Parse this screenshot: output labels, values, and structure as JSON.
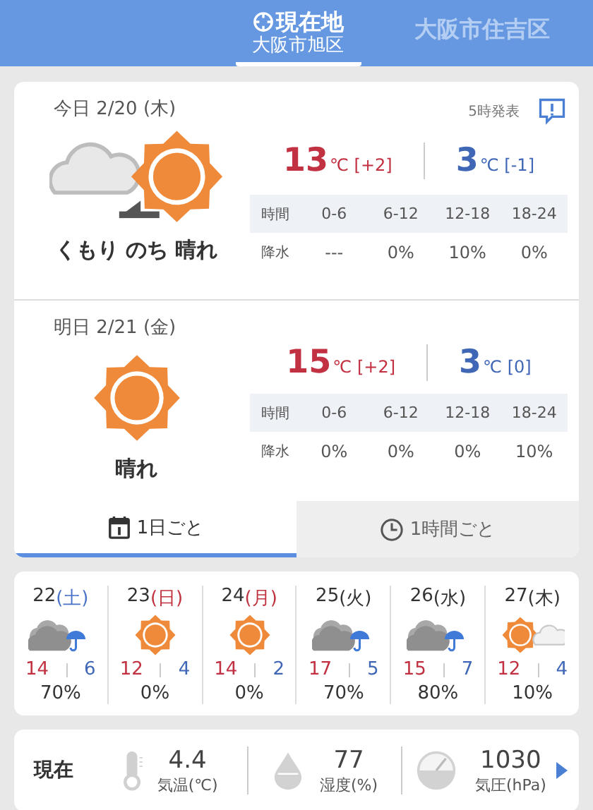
{
  "header": {
    "tabs": [
      {
        "title": "現在地",
        "subtitle": "大阪市旭区",
        "selected": true,
        "kind": "location"
      },
      {
        "title": "大阪市住吉区",
        "selected": false,
        "kind": "city"
      }
    ]
  },
  "days": [
    {
      "date": "今日 2/20 (木)",
      "issued": "5時発表",
      "report": true,
      "kind": "cloudy-then-sunny",
      "weather": "くもり のち 晴れ",
      "high": "13",
      "high_unit": "℃",
      "high_diff": "[+2]",
      "low": "3",
      "low_unit": "℃",
      "low_diff": "[-1]",
      "table": [
        {
          "kind": "head",
          "cells": [
            "時間",
            "0-6",
            "6-12",
            "12-18",
            "18-24"
          ]
        },
        {
          "kind": "body",
          "cells": [
            "降水",
            "---",
            "0%",
            "10%",
            "0%"
          ]
        }
      ]
    },
    {
      "date": "明日 2/21 (金)",
      "kind": "sunny",
      "weather": "晴れ",
      "high": "15",
      "high_unit": "℃",
      "high_diff": "[+2]",
      "low": "3",
      "low_unit": "℃",
      "low_diff": "[0]",
      "table": [
        {
          "kind": "head",
          "cells": [
            "時間",
            "0-6",
            "6-12",
            "12-18",
            "18-24"
          ]
        },
        {
          "kind": "body",
          "cells": [
            "降水",
            "0%",
            "0%",
            "0%",
            "10%"
          ]
        }
      ]
    }
  ],
  "view_tabs": [
    {
      "label": "1日ごと",
      "kind": "calendar",
      "selected": true
    },
    {
      "label": "1時間ごと",
      "kind": "clock",
      "selected": false
    }
  ],
  "week": [
    {
      "day": "22",
      "weekday": "(土)",
      "color": "#4a72c8",
      "kind": "cloudy-rain",
      "high": "14",
      "low": "6",
      "rain": "70%"
    },
    {
      "day": "23",
      "weekday": "(日)",
      "color": "#c0323f",
      "kind": "sunny",
      "high": "12",
      "low": "4",
      "rain": "0%"
    },
    {
      "day": "24",
      "weekday": "(月)",
      "color": "#c0323f",
      "kind": "sunny",
      "high": "14",
      "low": "2",
      "rain": "0%"
    },
    {
      "day": "25",
      "weekday": "(火)",
      "color": "#333333",
      "kind": "cloudy-rain",
      "high": "17",
      "low": "5",
      "rain": "70%"
    },
    {
      "day": "26",
      "weekday": "(水)",
      "color": "#333333",
      "kind": "cloudy-rain",
      "high": "15",
      "low": "7",
      "rain": "80%"
    },
    {
      "day": "27",
      "weekday": "(木)",
      "color": "#333333",
      "kind": "sunny-cloudy",
      "high": "12",
      "low": "4",
      "rain": "10%"
    }
  ],
  "current": {
    "label": "現在",
    "items": [
      {
        "kind": "temperature",
        "value": "4.4",
        "label": "気温(℃)"
      },
      {
        "kind": "humidity",
        "value": "77",
        "label": "湿度(%)"
      },
      {
        "kind": "pressure",
        "value": "1030",
        "label": "気圧(hPa)"
      }
    ]
  }
}
